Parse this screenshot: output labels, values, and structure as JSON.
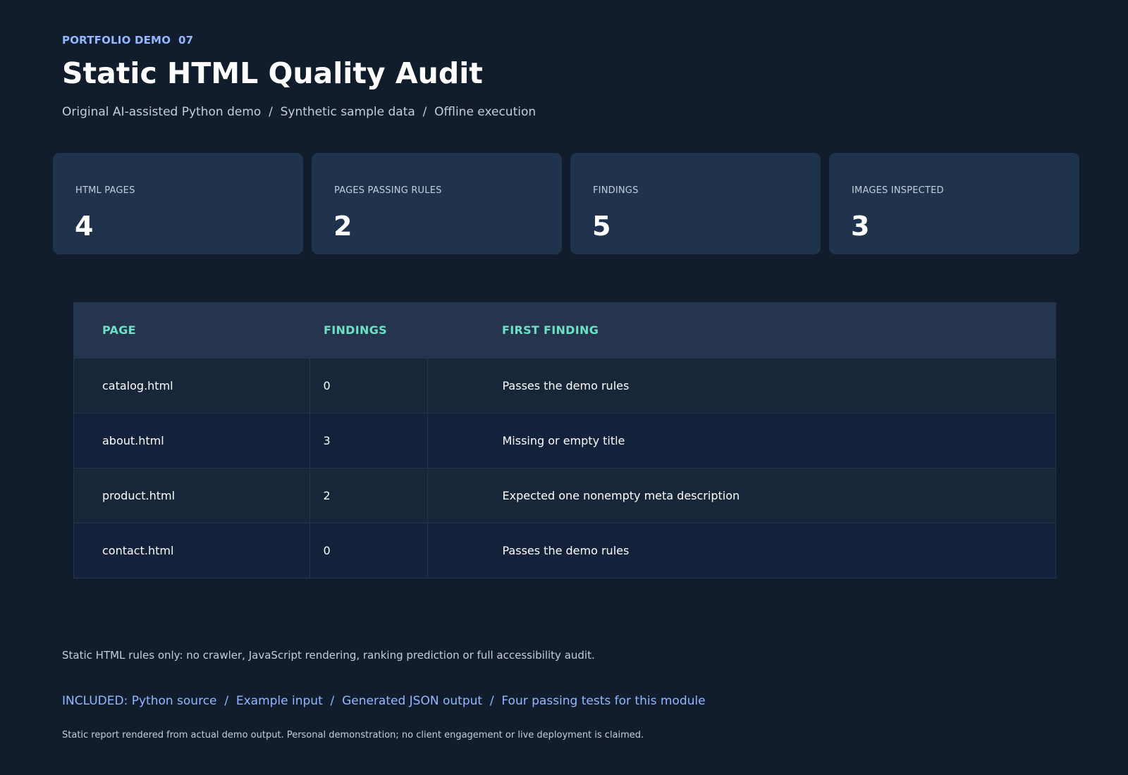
{
  "header": {
    "eyebrow": "PORTFOLIO DEMO  07",
    "title": "Static HTML Quality Audit",
    "subtitle": "Original AI-assisted Python demo  /  Synthetic sample data  /  Offline execution"
  },
  "stats": [
    {
      "label": "HTML PAGES",
      "value": "4"
    },
    {
      "label": "PAGES PASSING RULES",
      "value": "2"
    },
    {
      "label": "FINDINGS",
      "value": "5"
    },
    {
      "label": "IMAGES INSPECTED",
      "value": "3"
    }
  ],
  "table": {
    "headers": [
      "PAGE",
      "FINDINGS",
      "FIRST FINDING"
    ],
    "rows": [
      {
        "page": "catalog.html",
        "findings": "0",
        "first_finding": "Passes the demo rules"
      },
      {
        "page": "about.html",
        "findings": "3",
        "first_finding": "Missing or empty title"
      },
      {
        "page": "product.html",
        "findings": "2",
        "first_finding": "Expected one nonempty meta description"
      },
      {
        "page": "contact.html",
        "findings": "0",
        "first_finding": "Passes the demo rules"
      }
    ]
  },
  "footer": {
    "note": "Static HTML rules only: no crawler, JavaScript rendering, ranking prediction or full accessibility audit.",
    "included": "INCLUDED: Python source  /  Example input  /  Generated JSON output  /  Four passing tests for this module",
    "disclaimer": "Static report rendered from actual demo output. Personal demonstration; no client engagement or live deployment is claimed."
  },
  "colors": {
    "background": "#111c2d",
    "card": "#20334d",
    "accent_teal": "#6ee0c6",
    "accent_blue": "#93b8ff"
  }
}
